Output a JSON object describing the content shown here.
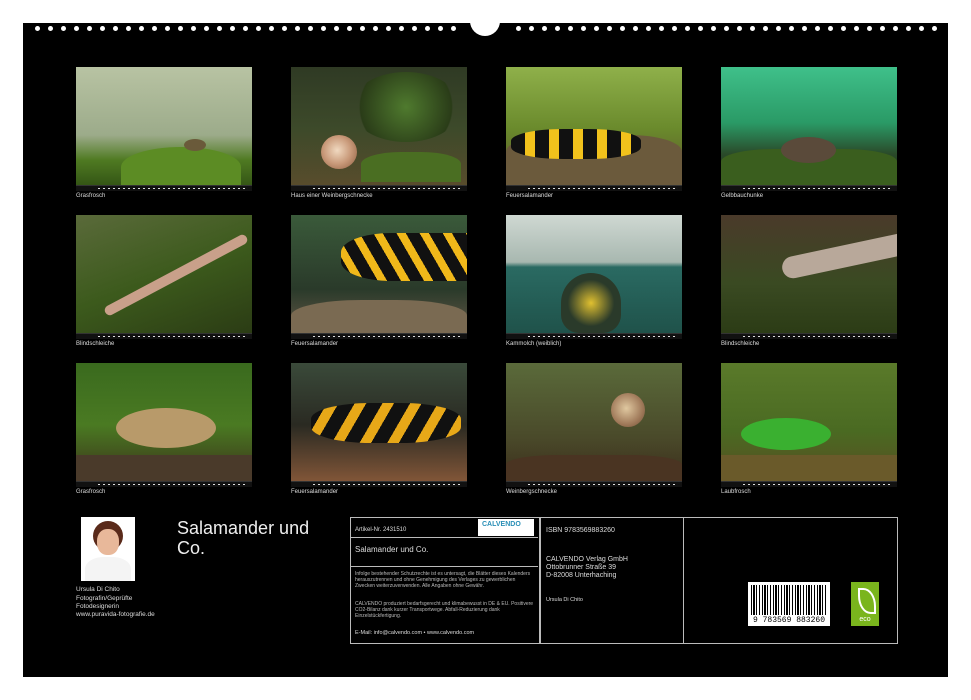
{
  "captions": [
    "Grasfrosch",
    "Haus einer Weinbergschnecke",
    "Feuersalamander",
    "Gelbbauchunke",
    "Blindschleiche",
    "Feuersalamander",
    "Kammolch (weiblich)",
    "Blindschleiche",
    "Grasfrosch",
    "Feuersalamander",
    "Weinbergschnecke",
    "Laubfrosch"
  ],
  "title": "Salamander und Co.",
  "author": {
    "name": "Ursula Di Chito",
    "role1": "Fotografin/Geprüfte",
    "role2": "Fotodesignerin",
    "web": "www.puravida-fotografie.de"
  },
  "info": {
    "artikel": "Artikel-Nr. 2431510",
    "logo": "CALVENDO",
    "product_title": "Salamander und Co.",
    "legal": "Infolge bestehender Schutzrechte ist es untersagt, die Blätter dieses Kalenders herauszutrennen und ohne Genehmigung des Verlages zu gewerblichen Zwecken weiterzuverwenden. Alle Angaben ohne Gewähr.",
    "eco_text": "CALVENDO produziert bedarfsgerecht und klimabewusst in DE & EU. Positivere CO2-Bilanz dank kurzer Transportwege. Abfall-Reduzierung dank Einzelstückfertigung.",
    "contact": "E-Mail: info@calvendo.com • www.calvendo.com",
    "isbn": "ISBN 9783569883260",
    "publisher1": "CALVENDO Verlag GmbH",
    "publisher2": "Ottobrunner Straße 39",
    "publisher3": "D-82008 Unterhaching",
    "author_small": "Ursula Di Chito",
    "barcode_number": "9 783569 883260",
    "eco_label": "eco"
  }
}
